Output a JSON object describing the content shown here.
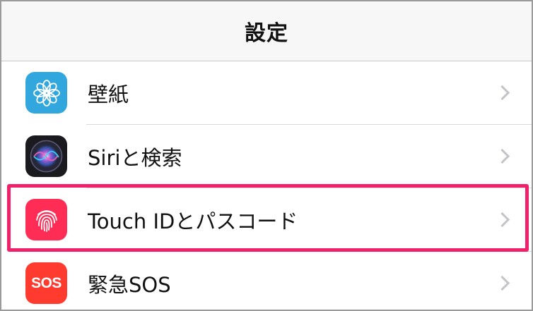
{
  "navbar": {
    "title": "設定"
  },
  "rows": [
    {
      "label": "壁紙",
      "icon": "flower-icon",
      "color": "#32a7dd"
    },
    {
      "label": "Siriと検索",
      "icon": "siri-icon",
      "color": "#1b1b1f"
    },
    {
      "label": "Touch IDとパスコード",
      "icon": "fingerprint-icon",
      "color": "#ff2d55"
    },
    {
      "label": "緊急SOS",
      "icon": "sos-icon",
      "icon_text": "SOS",
      "color": "#ff3b30"
    }
  ],
  "highlight_color": "#f0206b"
}
